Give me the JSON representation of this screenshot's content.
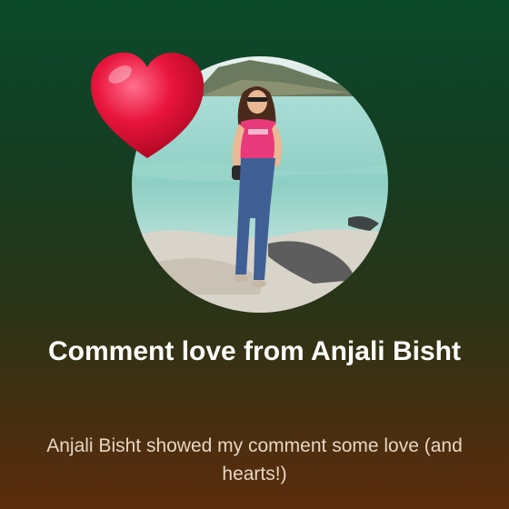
{
  "notification": {
    "title": "Comment love from Anjali Bisht",
    "message": "Anjali Bisht showed my comment some love (and hearts!)",
    "avatar": "profile-photo",
    "badge": "heart-icon"
  },
  "colors": {
    "background_top": "#0c4a2c",
    "background_bottom": "#5a2c0c",
    "heart": "#e8143c",
    "message_text": "#e6d6c3"
  }
}
